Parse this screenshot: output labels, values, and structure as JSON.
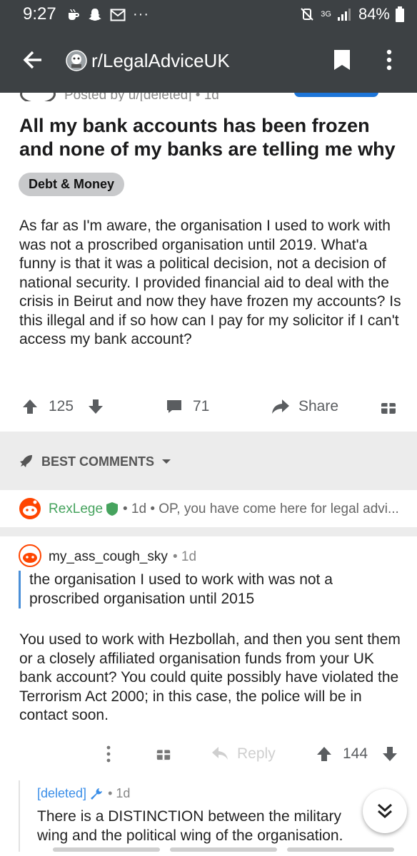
{
  "status_bar": {
    "time": "9:27",
    "left_icons": [
      "coffee-cup-icon",
      "snapchat-ghost-icon",
      "mail-icon",
      "more-dots-icon"
    ],
    "network": "3G",
    "battery": "84%"
  },
  "app_bar": {
    "subreddit": "r/LegalAdviceUK",
    "icons": [
      "back-arrow-icon",
      "subreddit-avatar-icon",
      "bookmark-icon",
      "overflow-menu-icon"
    ],
    "background": "#3d4144"
  },
  "post": {
    "byline_partial": "Posted by u/[deleted] • 1d",
    "title": "All my bank accounts has been frozen and none of my banks are telling me why",
    "flair": "Debt & Money",
    "body": "As far as I'm aware, the organisation I used to work with was not a proscribed organisation until 2019. What'a funny is that it was a political decision, not a decision of national security. I provided financial aid to deal with the crisis in Beirut and now they have frozen my accounts? Is this illegal and if so how can I pay for my solicitor if I can't access my bank account?",
    "votes": "125",
    "comments": "71",
    "share_label": "Share"
  },
  "sort": {
    "label": "BEST COMMENTS"
  },
  "comments": {
    "collapsed": {
      "author": "RexLege",
      "meta": "• 1d • OP, you have come here for legal advi..."
    },
    "main": {
      "author": "my_ass_cough_sky",
      "meta": "• 1d",
      "quote": "the organisation I used to work with was not a proscribed organisation until 2015",
      "body": "You used to work with Hezbollah, and then you sent them or a closely affiliated organisation funds from your UK bank account? You could quite possibly have violated the Terrorism Act 2000; in this case, the police will be in contact soon.",
      "reply_label": "Reply",
      "votes": "144"
    },
    "reply": {
      "author": "[deleted]",
      "meta": "• 1d",
      "body": "There is a DISTINCTION between the military wing and the political wing of the organisation."
    }
  },
  "colors": {
    "accent_blue": "#3a8ee8",
    "mod_green": "#46a35e",
    "separator": "#ececec"
  }
}
